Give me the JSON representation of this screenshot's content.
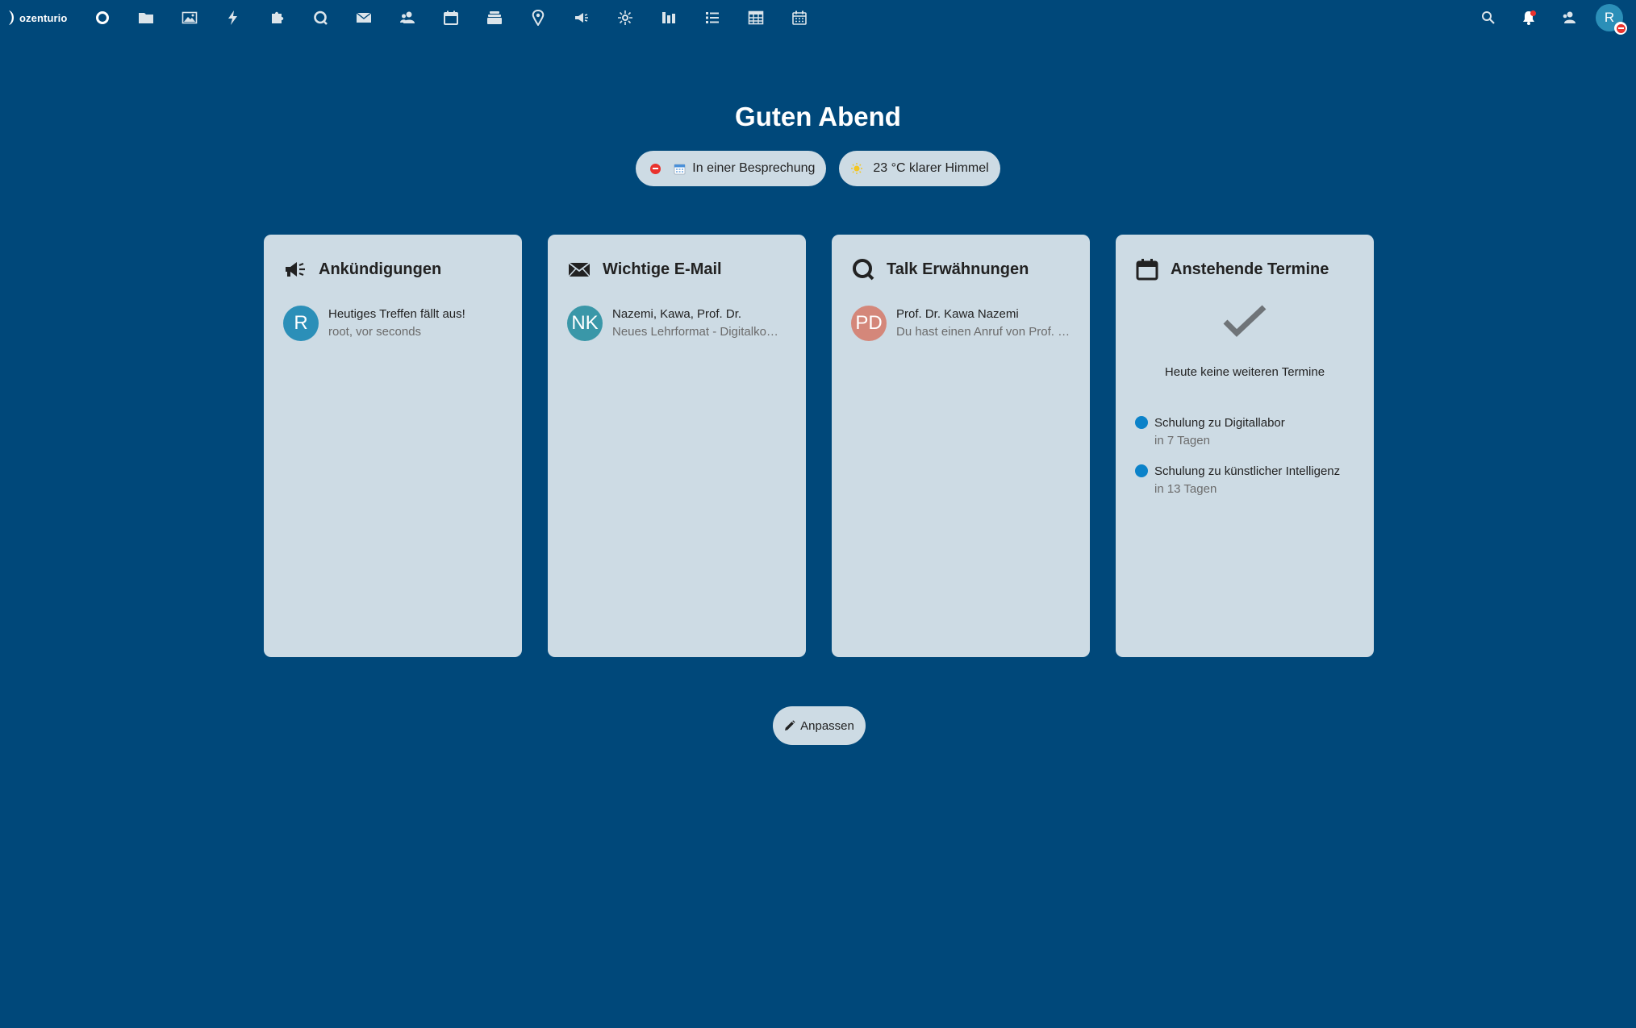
{
  "brand": {
    "name": "ozenturio"
  },
  "apps": [
    {
      "name": "dashboard",
      "icon": "dashboard-icon"
    },
    {
      "name": "files",
      "icon": "folder-icon"
    },
    {
      "name": "photos",
      "icon": "image-icon"
    },
    {
      "name": "activity",
      "icon": "lightning-icon"
    },
    {
      "name": "collectives",
      "icon": "puzzle-icon"
    },
    {
      "name": "talk",
      "icon": "chat-bubble-icon"
    },
    {
      "name": "mail",
      "icon": "envelope-icon"
    },
    {
      "name": "contacts",
      "icon": "contacts-icon"
    },
    {
      "name": "calendar",
      "icon": "calendar-icon"
    },
    {
      "name": "deck",
      "icon": "stack-icon"
    },
    {
      "name": "maps",
      "icon": "map-pin-icon"
    },
    {
      "name": "announcements",
      "icon": "megaphone-icon"
    },
    {
      "name": "circles",
      "icon": "sun-star-icon"
    },
    {
      "name": "analytics",
      "icon": "bar-chart-icon"
    },
    {
      "name": "tasks",
      "icon": "list-icon"
    },
    {
      "name": "tables",
      "icon": "table-icon"
    },
    {
      "name": "calendar-alt",
      "icon": "calendar-grid-icon"
    }
  ],
  "header_right": {
    "user_initial": "R"
  },
  "greeting": "Guten Abend",
  "status": {
    "user_status": "In einer Besprechung",
    "weather": "23 °C klarer Himmel"
  },
  "panels": {
    "announcements": {
      "title": "Ankündigungen",
      "items": [
        {
          "avatar": "R",
          "avatar_color": "#2b8fb8",
          "title": "Heutiges Treffen fällt aus!",
          "sub": "root, vor seconds"
        }
      ]
    },
    "mail": {
      "title": "Wichtige E-Mail",
      "items": [
        {
          "avatar": "NK",
          "avatar_color": "#3a97a8",
          "title": "Nazemi, Kawa, Prof. Dr.",
          "sub": "Neues Lehrformat - Digitalkompetenz"
        }
      ]
    },
    "talk": {
      "title": "Talk Erwähnungen",
      "items": [
        {
          "avatar": "PD",
          "avatar_color": "#d4877a",
          "title": "Prof. Dr. Kawa Nazemi",
          "sub": "Du hast einen Anruf von Prof. Dr. Kawa Nazemi verpasst"
        }
      ]
    },
    "calendar": {
      "title": "Anstehende Termine",
      "empty_text": "Heute keine weiteren Termine",
      "events": [
        {
          "title": "Schulung zu Digitallabor",
          "sub": "in 7 Tagen"
        },
        {
          "title": "Schulung zu künstlicher Intelligenz",
          "sub": "in 13 Tagen"
        }
      ]
    }
  },
  "customize_label": "Anpassen",
  "colors": {
    "background": "#00487a",
    "panel": "#cddbe4",
    "event_dot": "#0b82c9",
    "dnd": "#e9322d"
  }
}
